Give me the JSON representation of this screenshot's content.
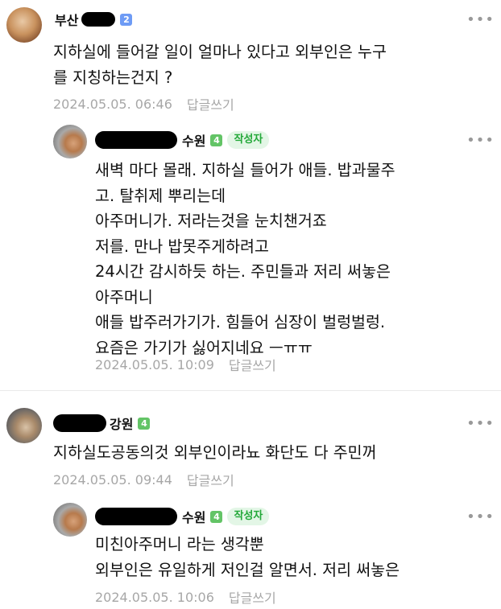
{
  "comments": [
    {
      "name": "부산",
      "level": "2",
      "more": "•••",
      "text": "지하실에 들어갈 일이 얼마나 있다고 외부인은 누구\n를 지칭하는건지 ?",
      "date": "2024.05.05. 06:46",
      "reply_label": "답글쓰기"
    },
    {
      "name": "수원",
      "level": "4",
      "badge": "작성자",
      "more": "•••",
      "text": "새벽 마다 몰래. 지하실 들어가 애들. 밥과물주\n고. 탈취제 뿌리는데\n아주머니가. 저라는것을 눈치챈거죠\n저를. 만나 밥못주게하려고\n24시간 감시하듯 하는. 주민들과 저리 써놓은\n아주머니\n애들 밥주러가기가. 힘들어 심장이 벌렁벌렁.\n요즘은 가기가 싫어지네요 ㅡㅠㅠ",
      "date": "2024.05.05. 10:09",
      "reply_label": "답글쓰기"
    },
    {
      "name": "강원",
      "level": "4",
      "more": "•••",
      "text": "지하실도공동의것 외부인이라뇨 화단도 다 주민꺼",
      "date": "2024.05.05. 09:44",
      "reply_label": "답글쓰기"
    },
    {
      "name": "수원",
      "level": "4",
      "badge": "작성자",
      "more": "•••",
      "text": "미친아주머니 라는 생각뿐\n외부인은 유일하게 저인걸 알면서. 저리 써놓은",
      "date": "2024.05.05. 10:06",
      "reply_label": "답글쓰기"
    }
  ]
}
